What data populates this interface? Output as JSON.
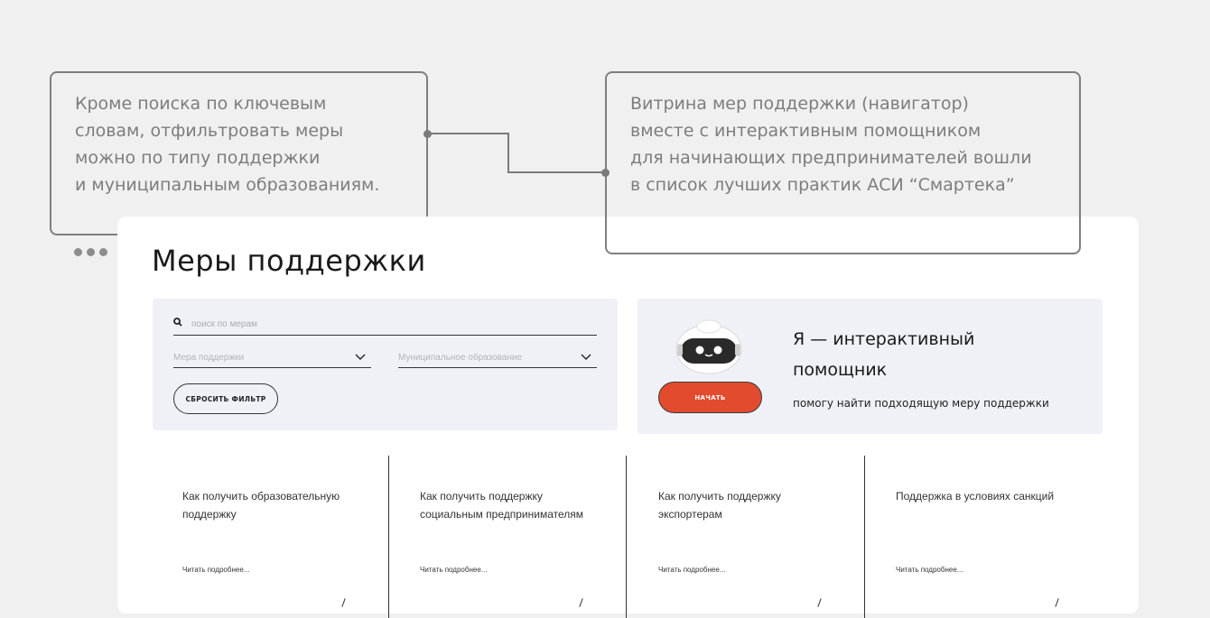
{
  "callouts": {
    "left": "Кроме поиска по ключевым\nсловам, отфильтровать меры\nможно по типу поддержки\nи муниципальным образованиям.",
    "right": "Витрина мер поддержки (навигатор)\nвместе с интерактивным помощником\nдля начинающих предпринимателей вошли\nв список лучших практик АСИ “Смартека”"
  },
  "page": {
    "title": "Меры поддержки"
  },
  "filters": {
    "search_placeholder": "поиск по мерам",
    "measure_select": "Мера поддержки",
    "municipal_select": "Муниципальное образование",
    "reset_label": "СБРОСИТЬ ФИЛЬТР"
  },
  "assistant": {
    "title": "Я — интерактивный помощник",
    "subtitle": "помогу найти подходящую меру поддержки",
    "start_label": "НАЧАТЬ"
  },
  "articles": [
    {
      "title": "Как получить образовательную поддержку",
      "more": "Читать подробнее..."
    },
    {
      "title": "Как получить поддержку социальным предпринимателям",
      "more": "Читать подробнее..."
    },
    {
      "title": "Как получить поддержку экспортерам",
      "more": "Читать подробнее..."
    },
    {
      "title": "Поддержка в условиях санкций",
      "more": "Читать подробнее..."
    }
  ],
  "colors": {
    "accent": "#e34b2e",
    "panel": "#f0f1f7",
    "background": "#f0f0f0"
  },
  "icons": [
    "search-icon",
    "chevron-down-icon",
    "robot-icon",
    "more-dots-icon"
  ]
}
